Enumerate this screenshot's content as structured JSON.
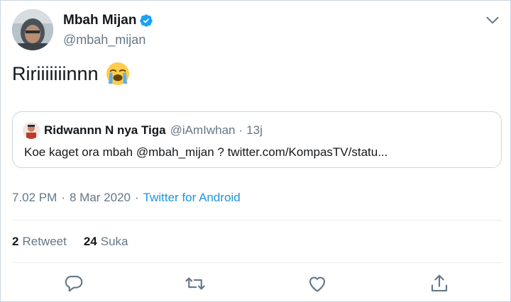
{
  "author": {
    "name": "Mbah Mijan",
    "handle": "@mbah_mijan",
    "verified": true
  },
  "tweet": {
    "text": "Ririiiiiiinnn",
    "emoji": "loudly-crying-face"
  },
  "quoted_tweet": {
    "name": "Ridwannn N nya Tiga",
    "handle": "@iAmIwhan",
    "dot": "·",
    "time": "13j",
    "text": "Koe kaget ora mbah @mbah_mijan ? twitter.com/KompasTV/statu..."
  },
  "meta": {
    "time": "7.02 PM",
    "sep1": "·",
    "date": "8 Mar 2020",
    "sep2": "·",
    "source": "Twitter for Android"
  },
  "stats": {
    "retweets_count": "2",
    "retweets_label": "Retweet",
    "likes_count": "24",
    "likes_label": "Suka"
  },
  "colors": {
    "link": "#1b95e0",
    "muted": "#657786",
    "border": "#ccd6dd",
    "verified": "#1da1f2"
  },
  "icons": [
    "chevron-down-icon",
    "verified-badge-icon",
    "reply-icon",
    "retweet-icon",
    "like-icon",
    "share-icon"
  ]
}
